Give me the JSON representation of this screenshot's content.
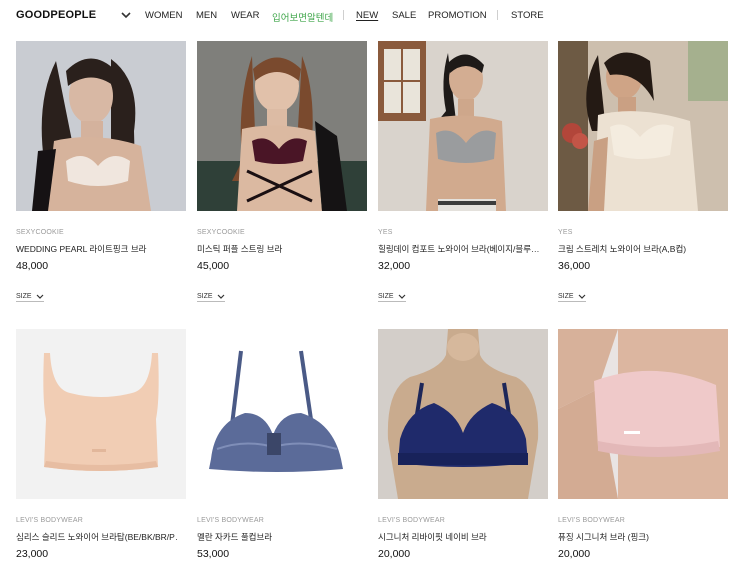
{
  "header": {
    "logo": "GOODPEOPLE",
    "nav": [
      "WOMEN",
      "MEN",
      "WEAR",
      "입어보면알텐데",
      "NEW",
      "SALE",
      "PROMOTION",
      "STORE"
    ],
    "highlight_color": "#3fa64a"
  },
  "products": [
    {
      "brand": "SEXYCOOKIE",
      "name": "WEDDING PEARL 라이트핑크 브라",
      "price": "48,000",
      "size_label": "SIZE"
    },
    {
      "brand": "SEXYCOOKIE",
      "name": "미스틱 퍼플 스트링 브라",
      "price": "45,000",
      "size_label": "SIZE"
    },
    {
      "brand": "YES",
      "name": "힐링데이 컴포트 노와이어 브라(베이지/블루…",
      "price": "32,000",
      "size_label": "SIZE"
    },
    {
      "brand": "YES",
      "name": "크림 스트레치 노와이어 브라(A,B컵)",
      "price": "36,000",
      "size_label": "SIZE"
    },
    {
      "brand": "LEVI'S BODYWEAR",
      "name": "심리스 슬리드 노와이어 브라탑(BE/BK/BR/P…",
      "price": "23,000"
    },
    {
      "brand": "LEVI'S BODYWEAR",
      "name": "멜란 자카드 풀컵브라",
      "price": "53,000"
    },
    {
      "brand": "LEVI'S BODYWEAR",
      "name": "시그니처 리바이핏 네이비 브라",
      "price": "20,000"
    },
    {
      "brand": "LEVI'S BODYWEAR",
      "name": "퓨징 시그니처 브라 (핑크)",
      "price": "20,000"
    }
  ]
}
